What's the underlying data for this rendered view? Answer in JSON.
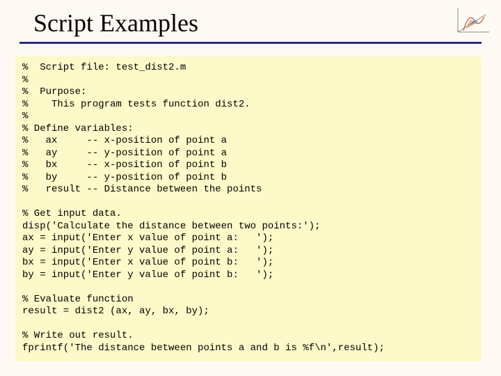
{
  "title": "Script Examples",
  "code": "%  Script file: test_dist2.m\n%\n%  Purpose:\n%    This program tests function dist2.\n%\n% Define variables:\n%   ax     -- x-position of point a\n%   ay     -- y-position of point a\n%   bx     -- x-position of point b\n%   by     -- y-position of point b\n%   result -- Distance between the points\n\n% Get input data.\ndisp('Calculate the distance between two points:');\nax = input('Enter x value of point a:   ');\nay = input('Enter y value of point a:   ');\nbx = input('Enter x value of point b:   ');\nby = input('Enter y value of point b:   ');\n\n% Evaluate function\nresult = dist2 (ax, ay, bx, by);\n\n% Write out result.\nfprintf('The distance between points a and b is %f\\n',result);"
}
